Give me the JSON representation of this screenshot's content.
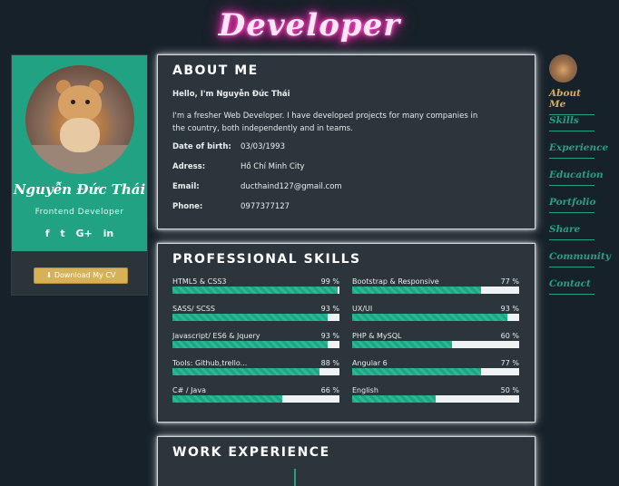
{
  "brand": {
    "title": "Developer"
  },
  "profile": {
    "name": "Nguyễn Đức Thái",
    "role": "Frontend Developer",
    "socials": [
      "f",
      "t",
      "G+",
      "in"
    ],
    "download_label": "Download My CV"
  },
  "about": {
    "heading": "ABOUT ME",
    "hello": "Hello, I'm Nguyễn Đức Thái",
    "description": "I'm a fresher Web Developer. I have developed projects for many companies in the country, both independently and in teams.",
    "rows": [
      {
        "key": "Date of birth:",
        "value": "03/03/1993"
      },
      {
        "key": "Adress:",
        "value": "Hồ Chí Minh City"
      },
      {
        "key": "Email:",
        "value": "ducthaind127@gmail.com"
      },
      {
        "key": "Phone:",
        "value": "0977377127"
      }
    ]
  },
  "skills": {
    "heading": "PROFESSIONAL SKILLS",
    "items": [
      {
        "label": "HTML5 & CSS3",
        "pct_text": "99 %",
        "value": 99
      },
      {
        "label": "Bootstrap & Responsive",
        "pct_text": "77 %",
        "value": 77
      },
      {
        "label": "SASS/ SCSS",
        "pct_text": "93 %",
        "value": 93
      },
      {
        "label": "UX/UI",
        "pct_text": "93 %",
        "value": 93
      },
      {
        "label": "Javascript/ ES6 & Jquery",
        "pct_text": "93 %",
        "value": 93
      },
      {
        "label": "PHP & MySQL",
        "pct_text": "60 %",
        "value": 60
      },
      {
        "label": "Tools: Github,trello...",
        "pct_text": "88 %",
        "value": 88
      },
      {
        "label": "Angular 6",
        "pct_text": "77 %",
        "value": 77
      },
      {
        "label": "C# / Java",
        "pct_text": "66 %",
        "value": 66
      },
      {
        "label": "English",
        "pct_text": "50 %",
        "value": 50
      }
    ]
  },
  "work": {
    "heading": "WORK EXPERIENCE"
  },
  "nav": {
    "items": [
      {
        "label": "About Me",
        "active": true
      },
      {
        "label": "Skills",
        "active": false
      },
      {
        "label": "Experience",
        "active": false
      },
      {
        "label": "Education",
        "active": false
      },
      {
        "label": "Portfolio",
        "active": false
      },
      {
        "label": "Share",
        "active": false
      },
      {
        "label": "Community",
        "active": false
      },
      {
        "label": "Contact",
        "active": false
      }
    ]
  },
  "colors": {
    "accent": "#21a283",
    "gold": "#d6b158",
    "background": "#172129",
    "panel": "#2b353b",
    "neon": "#ff2fb8"
  }
}
